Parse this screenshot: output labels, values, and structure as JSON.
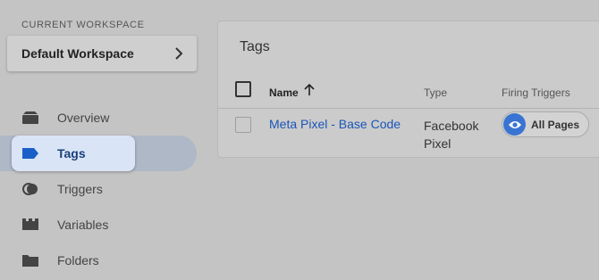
{
  "workspace": {
    "section_label": "CURRENT WORKSPACE",
    "name": "Default Workspace"
  },
  "nav": {
    "items": [
      {
        "label": "Overview",
        "icon": "overview-icon"
      },
      {
        "label": "Tags",
        "icon": "tag-icon",
        "active": true
      },
      {
        "label": "Triggers",
        "icon": "triggers-icon"
      },
      {
        "label": "Variables",
        "icon": "variables-icon"
      },
      {
        "label": "Folders",
        "icon": "folder-icon"
      }
    ]
  },
  "tags_panel": {
    "title": "Tags",
    "columns": {
      "name": "Name",
      "type": "Type",
      "firing_triggers": "Firing Triggers"
    },
    "sort": {
      "column": "Name",
      "direction": "ascending"
    },
    "rows": [
      {
        "name": "Meta Pixel - Base Code",
        "type": "Facebook Pixel",
        "trigger": "All Pages"
      }
    ]
  },
  "colors": {
    "link": "#1a56b8",
    "active_nav": "#d9e5f6",
    "trigger_icon": "#3a74d3"
  }
}
